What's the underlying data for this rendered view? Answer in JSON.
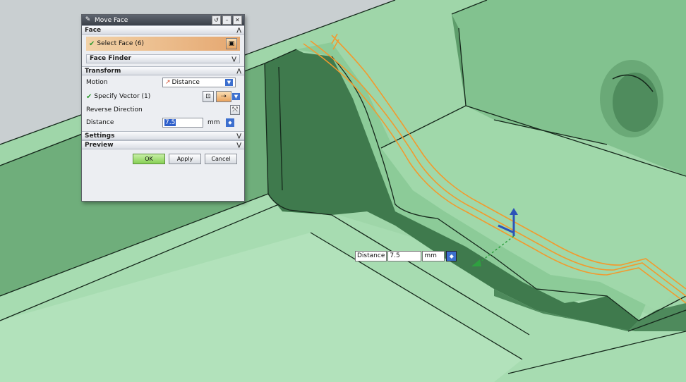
{
  "dialog": {
    "title": "Move Face",
    "title_icon": "move-face-icon",
    "sections": {
      "face": "Face",
      "transform": "Transform",
      "settings": "Settings",
      "preview": "Preview"
    },
    "select_face_label": "Select Face (6)",
    "face_finder_label": "Face Finder",
    "motion_label": "Motion",
    "motion_value": "Distance",
    "specify_vector_label": "Specify Vector (1)",
    "reverse_direction_label": "Reverse Direction",
    "distance_label": "Distance",
    "distance_value": "7.5",
    "distance_unit": "mm",
    "buttons": {
      "ok": "OK",
      "apply": "Apply",
      "cancel": "Cancel"
    },
    "colors": {
      "titlebar": "#4a5059",
      "select_highlight": "#e5a770",
      "ok_button": "#86cf54",
      "check": "#2f9b30"
    }
  },
  "viewport": {
    "floating_distance": {
      "label": "Distance",
      "value": "7.5",
      "unit": "mm"
    },
    "colors": {
      "model_face": "#a8dcb0",
      "model_dark": "#5d9a6a",
      "edge": "#15281b",
      "selected_edge": "#f29a2e",
      "background": "#c9cfd1"
    }
  }
}
